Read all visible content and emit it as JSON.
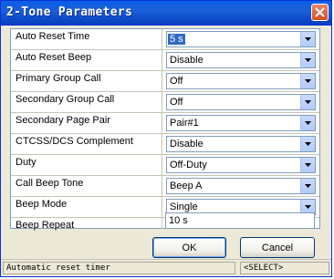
{
  "window": {
    "title": "2-Tone Parameters"
  },
  "fields": [
    {
      "label": "Auto Reset Time",
      "value": "5 s",
      "type": "select"
    },
    {
      "label": "Auto Reset Beep",
      "value": "Disable",
      "type": "select"
    },
    {
      "label": "Primary Group Call",
      "value": "Off",
      "type": "select"
    },
    {
      "label": "Secondary Group Call",
      "value": "Off",
      "type": "select"
    },
    {
      "label": "Secondary Page Pair",
      "value": "Pair#1",
      "type": "select"
    },
    {
      "label": "CTCSS/DCS Complement",
      "value": "Disable",
      "type": "select"
    },
    {
      "label": "Duty",
      "value": "Off-Duty",
      "type": "select"
    },
    {
      "label": "Call Beep Tone",
      "value": "Beep A",
      "type": "select"
    },
    {
      "label": "Beep Mode",
      "value": "Single",
      "type": "select"
    },
    {
      "label": "Beep Repeat",
      "value": "10 s",
      "type": "text"
    }
  ],
  "buttons": {
    "ok": "OK",
    "cancel": "Cancel"
  },
  "status": {
    "message": "Automatic reset timer",
    "mode": "<SELECT>"
  },
  "colors": {
    "title_bar": "#0a5fe6",
    "selection": "#316ac5",
    "close_button": "#d54c24"
  }
}
